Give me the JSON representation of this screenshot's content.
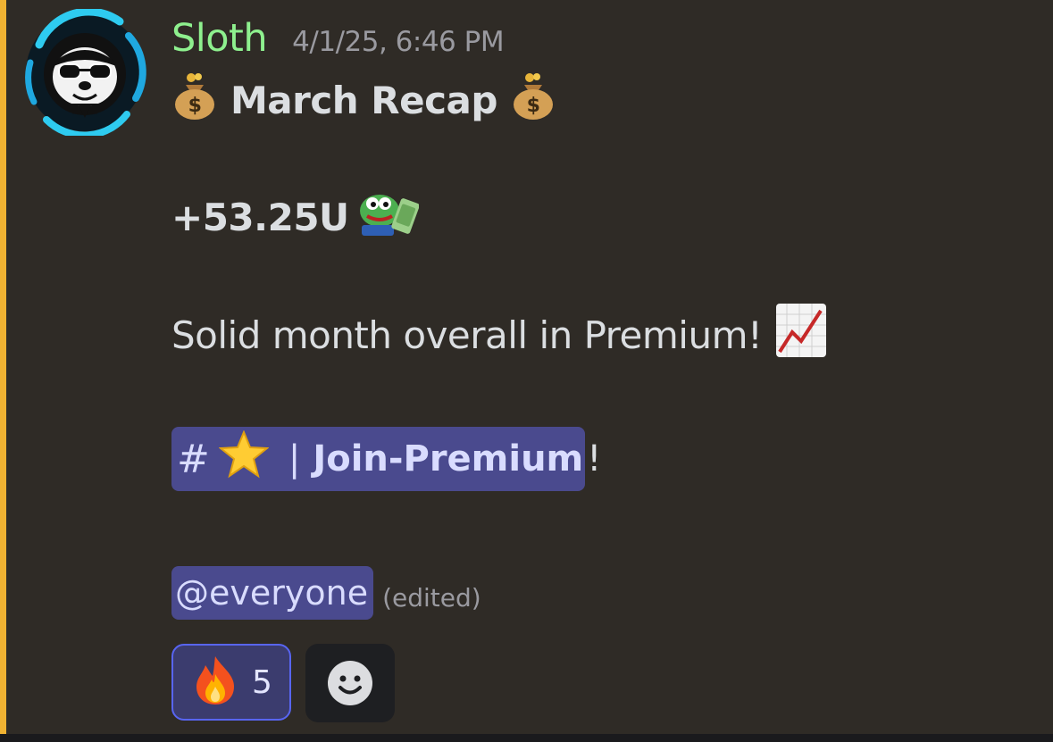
{
  "message": {
    "author": {
      "name": "Sloth",
      "name_color": "#8ef08e"
    },
    "timestamp": "4/1/25, 6:46 PM",
    "title": "March Recap",
    "profit": "+53.25U",
    "body_text": "Solid month overall in Premium!",
    "channel_mention": {
      "hash": "#",
      "separator": "|",
      "name": "Join-Premium",
      "trailing": "!"
    },
    "everyone_mention": "@everyone",
    "edited_label": "(edited)",
    "reactions": [
      {
        "emoji_icon": "fire-icon",
        "count": "5"
      }
    ],
    "icons": [
      "money-bag-icon",
      "pepe-cash-emoji",
      "chart-increasing-icon",
      "star-icon",
      "add-reaction-icon"
    ]
  },
  "colors": {
    "background": "#2f2b26",
    "highlight_bar": "#f0b232",
    "mention_background": "#4a4a8e",
    "mention_text": "#d9dcff",
    "reaction_border": "#5865f2"
  }
}
